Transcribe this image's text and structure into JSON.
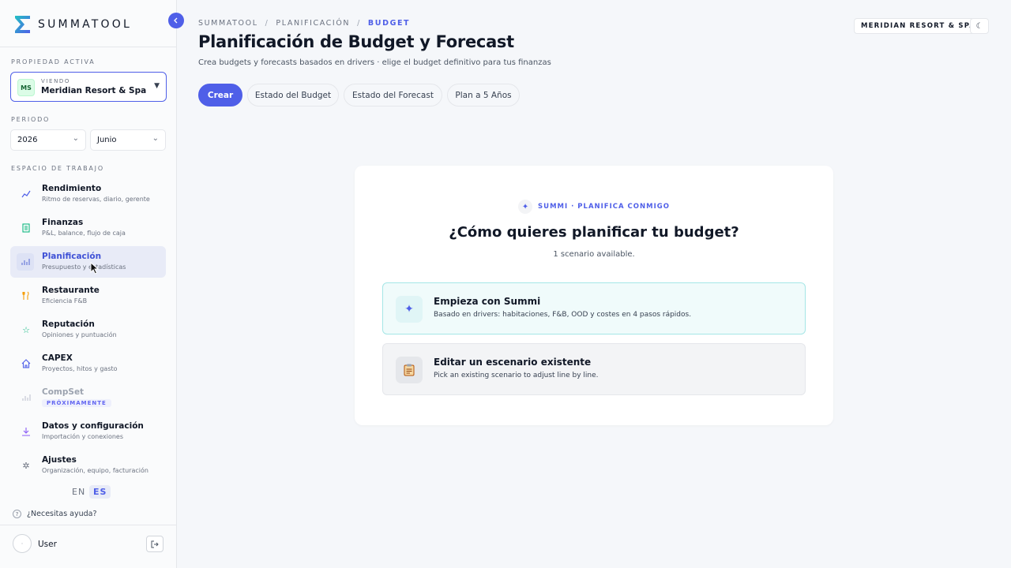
{
  "app": {
    "brand": "SUMMATOOL",
    "brand_color": "#4f5fe8"
  },
  "sidebar": {
    "active_property_label": "PROPIEDAD ACTIVA",
    "property": {
      "initials": "MS",
      "viewing_label": "VIENDO",
      "name": "Meridian Resort & Spa"
    },
    "period_label": "PERIODO",
    "year": "2026",
    "month": "Junio",
    "workspace_label": "ESPACIO DE TRABAJO",
    "items": [
      {
        "label": "Rendimiento",
        "sub": "Ritmo de reservas, diario, gerente",
        "icon": "trend-line-icon"
      },
      {
        "label": "Finanzas",
        "sub": "P&L, balance, flujo de caja",
        "icon": "ledger-icon"
      },
      {
        "label": "Planificación",
        "sub": "Presupuesto y estadísticas",
        "icon": "bar-chart-icon",
        "active": true
      },
      {
        "label": "Restaurante",
        "sub": "Eficiencia F&B",
        "icon": "cutlery-icon"
      },
      {
        "label": "Reputación",
        "sub": "Opiniones y puntuación",
        "icon": "star-icon"
      },
      {
        "label": "CAPEX",
        "sub": "Proyectos, hitos y gasto",
        "icon": "house-icon"
      },
      {
        "label": "CompSet",
        "badge": "PRÓXIMAMENTE",
        "icon": "bar-chart-icon",
        "disabled": true
      },
      {
        "label": "Datos y configuración",
        "sub": "Importación y conexiones",
        "icon": "download-icon"
      },
      {
        "label": "Ajustes",
        "sub": "Organización, equipo, facturación",
        "icon": "gear-icon"
      }
    ],
    "lang_en": "EN",
    "lang_es": "ES",
    "help": "¿Necesitas ayuda?",
    "user": "User"
  },
  "header": {
    "breadcrumb": [
      "SUMMATOOL",
      "PLANIFICACIÓN",
      "BUDGET"
    ],
    "title": "Planificación de Budget y Forecast",
    "subtitle": "Crea budgets y forecasts basados en drivers · elige el budget definitivo para tus finanzas",
    "property_pill": "MERIDIAN RESORT & SPA"
  },
  "tabs": [
    "Crear",
    "Estado del Budget",
    "Estado del Forecast",
    "Plan a 5 Años"
  ],
  "card": {
    "tag": "SUMMI · PLANIFICA CONMIGO",
    "title": "¿Cómo quieres planificar tu budget?",
    "subtitle": "1 scenario available.",
    "options": [
      {
        "title": "Empieza con Summi",
        "desc": "Basado en drivers: habitaciones, F&B, OOD y costes en 4 pasos rápidos.",
        "icon": "sparkle-icon"
      },
      {
        "title": "Editar un escenario existente",
        "desc": "Pick an existing scenario to adjust line by line.",
        "icon": "clipboard-icon"
      }
    ]
  }
}
